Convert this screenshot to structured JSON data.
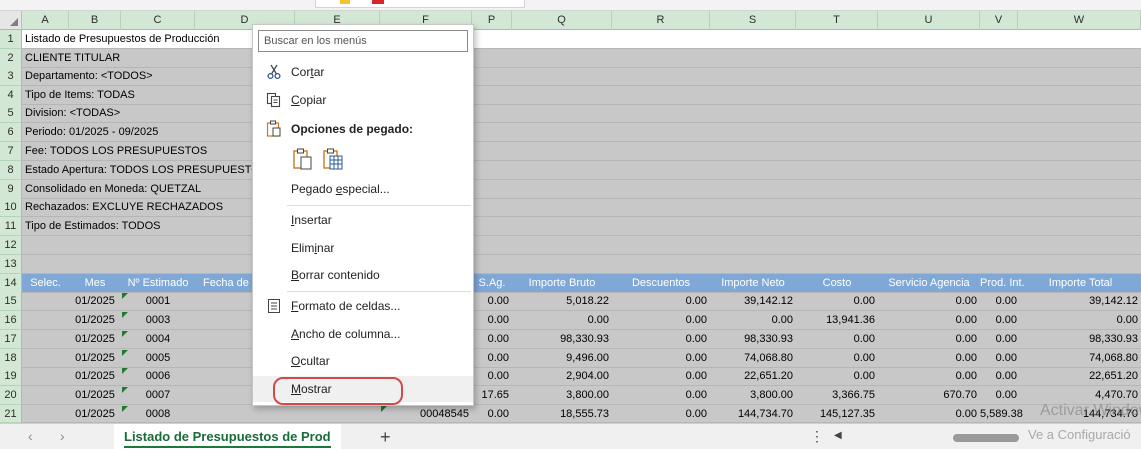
{
  "columns": [
    "A",
    "B",
    "C",
    "D",
    "",
    "E",
    "F",
    "P",
    "Q",
    "R",
    "S",
    "T",
    "U",
    "V",
    "W"
  ],
  "row_numbers": [
    "1",
    "2",
    "3",
    "4",
    "5",
    "6",
    "7",
    "8",
    "9",
    "10",
    "11",
    "12",
    "13",
    "14",
    "15",
    "16",
    "17",
    "18",
    "19",
    "20",
    "21"
  ],
  "report_lines": [
    "Listado de Presupuestos de Producción",
    "CLIENTE TITULAR",
    "Departamento: <TODOS>",
    "Tipo de Items: TODAS",
    "Division: <TODAS>",
    "Periodo: 01/2025 - 09/2025",
    "Fee: TODOS LOS PRESUPUESTOS",
    "Estado Apertura: TODOS LOS PRESUPUESTOS",
    "Consolidado en Moneda: QUETZAL",
    "Rechazados: EXCLUYE RECHAZADOS",
    "Tipo de Estimados: TODOS"
  ],
  "table_headers": [
    "Selec.",
    "Mes",
    "Nº Estimado",
    "Fecha de",
    "S.Ag.",
    "Importe Bruto",
    "Descuentos",
    "Importe Neto",
    "Costo",
    "Servicio Agencia",
    "Prod. Int.",
    "Importe Total"
  ],
  "rows": [
    {
      "mes": "01/2025",
      "num": "0001",
      "f": "",
      "sag": "0.00",
      "bruto": "5,018.22",
      "desc": "0.00",
      "neto": "39,142.12",
      "costo": "0.00",
      "serv": "0.00",
      "prod": "0.00",
      "total": "39,142.12"
    },
    {
      "mes": "01/2025",
      "num": "0003",
      "f": "",
      "sag": "0.00",
      "bruto": "0.00",
      "desc": "0.00",
      "neto": "0.00",
      "costo": "13,941.36",
      "serv": "0.00",
      "prod": "0.00",
      "total": "0.00"
    },
    {
      "mes": "01/2025",
      "num": "0004",
      "f": "",
      "sag": "0.00",
      "bruto": "98,330.93",
      "desc": "0.00",
      "neto": "98,330.93",
      "costo": "0.00",
      "serv": "0.00",
      "prod": "0.00",
      "total": "98,330.93"
    },
    {
      "mes": "01/2025",
      "num": "0005",
      "f": "",
      "sag": "0.00",
      "bruto": "9,496.00",
      "desc": "0.00",
      "neto": "74,068.80",
      "costo": "0.00",
      "serv": "0.00",
      "prod": "0.00",
      "total": "74,068.80"
    },
    {
      "mes": "01/2025",
      "num": "0006",
      "f": "",
      "sag": "0.00",
      "bruto": "2,904.00",
      "desc": "0.00",
      "neto": "22,651.20",
      "costo": "0.00",
      "serv": "0.00",
      "prod": "0.00",
      "total": "22,651.20"
    },
    {
      "mes": "01/2025",
      "num": "0007",
      "f": "",
      "sag": "17.65",
      "bruto": "3,800.00",
      "desc": "0.00",
      "neto": "3,800.00",
      "costo": "3,366.75",
      "serv": "670.70",
      "prod": "0.00",
      "total": "4,470.70"
    },
    {
      "mes": "01/2025",
      "num": "0008",
      "f": "00048545",
      "sag": "0.00",
      "bruto": "18,555.73",
      "desc": "0.00",
      "neto": "144,734.70",
      "costo": "145,127.35",
      "serv": "0.00",
      "prod": "5,589.38",
      "total": "144,734.70"
    }
  ],
  "context_menu": {
    "search_placeholder": "Buscar en los menús",
    "cortar": "Cortar",
    "copiar": "Copiar",
    "opciones_pegado": "Opciones de pegado:",
    "pegado_especial": "Pegado especial...",
    "insertar": "Insertar",
    "eliminar": "Eliminar",
    "borrar_contenido": "Borrar contenido",
    "formato_celdas": "Formato de celdas...",
    "ancho_columna": "Ancho de columna...",
    "ocultar": "Ocultar",
    "mostrar": "Mostrar"
  },
  "sheet_tab": "Listado de Presupuestos de Prod",
  "add_sheet": "+",
  "watermark_line1": "Activar Windows",
  "watermark_line2": "Ve a Configuració",
  "colors": {
    "header_blue": "#7fa8d6",
    "grid_gray": "#c8c8c8",
    "excel_green": "#1a7a3a",
    "highlight_red": "#d24b4b"
  }
}
